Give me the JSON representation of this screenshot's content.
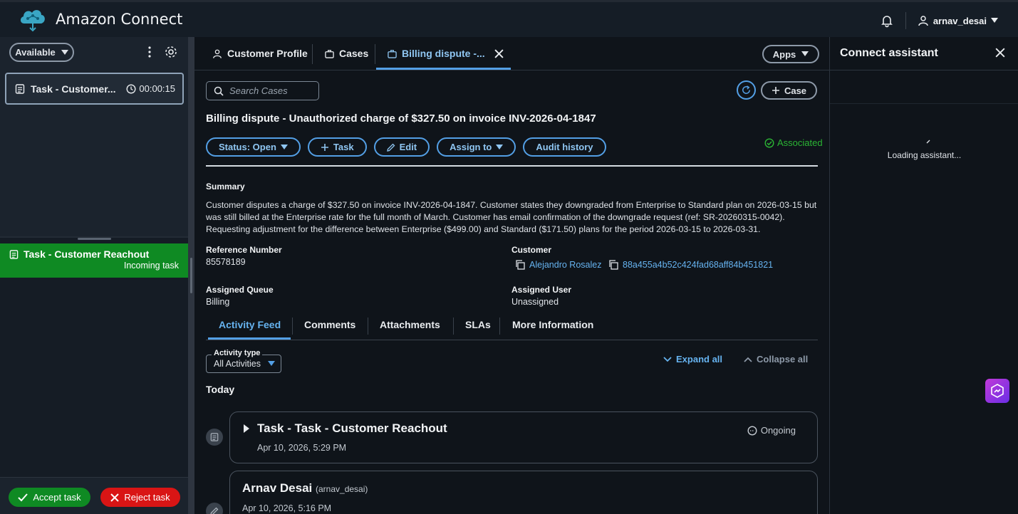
{
  "header": {
    "app_title": "Amazon Connect",
    "user": "arnav_desai"
  },
  "agent": {
    "status": "Available"
  },
  "contacts": [
    {
      "label": "Task - Customer...",
      "timer": "00:00:15"
    }
  ],
  "incoming": {
    "title": "Task - Customer Reachout",
    "subtitle": "Incoming task"
  },
  "actions": {
    "accept": "Accept task",
    "reject": "Reject task"
  },
  "tabs": [
    {
      "label": "Customer Profile"
    },
    {
      "label": "Cases"
    },
    {
      "label": "Billing dispute -..."
    }
  ],
  "apps_label": "Apps",
  "search": {
    "placeholder": "Search Cases"
  },
  "add_case_label": "Case",
  "case": {
    "title": "Billing dispute - Unauthorized charge of $327.50 on invoice INV-2026-04-1847",
    "buttons": {
      "status": "Status: Open",
      "task": "Task",
      "edit": "Edit",
      "assign": "Assign to",
      "audit": "Audit history"
    },
    "associated": "Associated",
    "summary_label": "Summary",
    "summary": "Customer disputes a charge of $327.50 on invoice INV-2026-04-1847. Customer states they downgraded from Enterprise to Standard plan on 2026-03-15 but was still billed at the Enterprise rate for the full month of March. Customer has email confirmation of the downgrade request (ref: SR-20260315-0042). Requesting adjustment for the difference between Enterprise ($499.00) and Standard ($171.50) plans for the period 2026-03-15 to 2026-03-31.",
    "reference_label": "Reference Number",
    "reference": "85578189",
    "customer_label": "Customer",
    "customer_name": "Alejandro Rosalez",
    "customer_id": "88a455a4b52c424fad68aff84b451821",
    "queue_label": "Assigned Queue",
    "queue": "Billing",
    "user_label": "Assigned User",
    "user": "Unassigned"
  },
  "subtabs": [
    {
      "label": "Activity Feed"
    },
    {
      "label": "Comments"
    },
    {
      "label": "Attachments"
    },
    {
      "label": "SLAs"
    },
    {
      "label": "More Information"
    }
  ],
  "activity": {
    "type_label": "Activity type",
    "type_value": "All Activities",
    "expand": "Expand all",
    "collapse": "Collapse all",
    "group": "Today",
    "items": [
      {
        "title": "Task - Task - Customer Reachout",
        "date": "Apr 10, 2026, 5:29 PM",
        "status": "Ongoing"
      },
      {
        "title": "Arnav Desai",
        "handle": "(arnav_desai)",
        "date": "Apr 10, 2026, 5:16 PM"
      }
    ]
  },
  "assistant": {
    "title": "Connect assistant",
    "loading": "Loading assistant..."
  },
  "colors": {
    "accent": "#539fe5",
    "success": "#0f8a23",
    "danger": "#d91515",
    "link": "#66b3f0"
  }
}
